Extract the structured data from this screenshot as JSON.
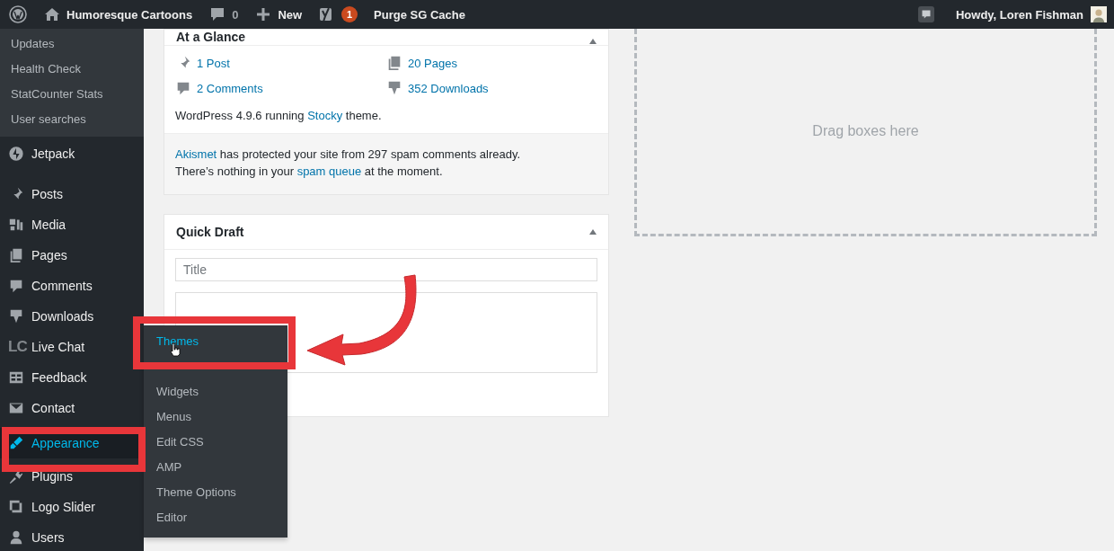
{
  "admin_bar": {
    "site_name": "Humoresque Cartoons",
    "comments_count": "0",
    "new_label": "New",
    "seo_badge": "1",
    "cache_label": "Purge SG Cache",
    "greeting": "Howdy, Loren Fishman"
  },
  "sidebar": {
    "submenu": [
      "Updates",
      "Health Check",
      "StatCounter Stats",
      "User searches"
    ],
    "items": [
      {
        "label": "Jetpack",
        "selected": false
      },
      {
        "label": "Posts",
        "selected": false
      },
      {
        "label": "Media",
        "selected": false
      },
      {
        "label": "Pages",
        "selected": false
      },
      {
        "label": "Comments",
        "selected": false
      },
      {
        "label": "Downloads",
        "selected": false
      },
      {
        "label": "Live Chat",
        "icon_text": "LC",
        "selected": false
      },
      {
        "label": "Feedback",
        "selected": false
      },
      {
        "label": "Contact",
        "selected": false
      },
      {
        "label": "Appearance",
        "selected": true
      },
      {
        "label": "Plugins",
        "selected": false
      },
      {
        "label": "Logo Slider",
        "selected": false
      },
      {
        "label": "Users",
        "selected": false
      }
    ]
  },
  "flyout": {
    "items": [
      {
        "label": "Themes",
        "selected": true
      },
      {
        "label": "Widgets",
        "selected": false
      },
      {
        "label": "Menus",
        "selected": false
      },
      {
        "label": "Edit CSS",
        "selected": false
      },
      {
        "label": "AMP",
        "selected": false
      },
      {
        "label": "Theme Options",
        "selected": false
      },
      {
        "label": "Editor",
        "selected": false
      }
    ]
  },
  "at_a_glance": {
    "title": "At a Glance",
    "stats": [
      "1 Post",
      "20 Pages",
      "2 Comments",
      "352 Downloads"
    ],
    "version": {
      "before": "WordPress 4.9.6 running ",
      "link": "Stocky",
      "after": " theme."
    },
    "akismet": [
      {
        "link": "Akismet",
        "after": " has protected your site from 297 spam comments already."
      },
      {
        "before": "There’s nothing in your ",
        "link": "spam queue",
        "after": " at the moment."
      }
    ]
  },
  "quick_draft": {
    "title": "Quick Draft",
    "title_placeholder": "Title"
  },
  "drop_zone": {
    "text": "Drag boxes here"
  }
}
